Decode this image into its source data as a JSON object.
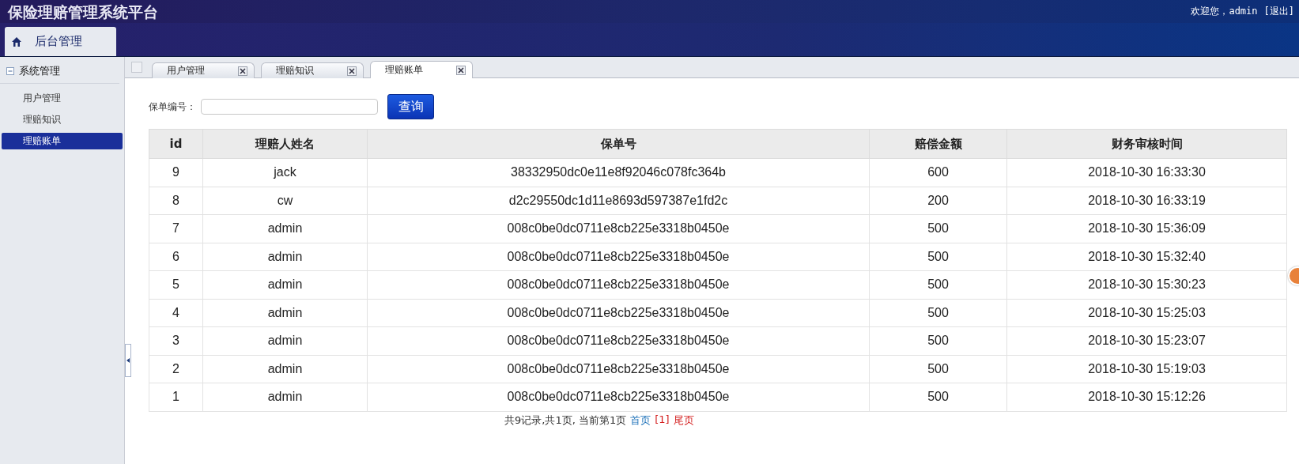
{
  "header": {
    "title": "保险理赔管理系统平台",
    "welcome": "欢迎您，admin",
    "logout": "[退出]"
  },
  "nav_tabs": [
    {
      "label": "后台管理",
      "selected": true
    }
  ],
  "sidebar": {
    "group": "系统管理",
    "expanded": true,
    "items": [
      {
        "label": "用户管理",
        "selected": false
      },
      {
        "label": "理赔知识",
        "selected": false
      },
      {
        "label": "理赔账单",
        "selected": true
      }
    ]
  },
  "tabs": [
    {
      "label": "用户管理",
      "selected": false
    },
    {
      "label": "理赔知识",
      "selected": false
    },
    {
      "label": "理赔账单",
      "selected": true
    }
  ],
  "search": {
    "label": "保单编号：",
    "button": "查询"
  },
  "table": {
    "columns": [
      "id",
      "理赔人姓名",
      "保单号",
      "赔偿金额",
      "财务审核时间"
    ],
    "rows": [
      [
        "9",
        "jack",
        "38332950dc0e11e8f92046c078fc364b",
        "600",
        "2018-10-30 16:33:30"
      ],
      [
        "8",
        "cw",
        "d2c29550dc1d11e8693d597387e1fd2c",
        "200",
        "2018-10-30 16:33:19"
      ],
      [
        "7",
        "admin",
        "008c0be0dc0711e8cb225e3318b0450e",
        "500",
        "2018-10-30 15:36:09"
      ],
      [
        "6",
        "admin",
        "008c0be0dc0711e8cb225e3318b0450e",
        "500",
        "2018-10-30 15:32:40"
      ],
      [
        "5",
        "admin",
        "008c0be0dc0711e8cb225e3318b0450e",
        "500",
        "2018-10-30 15:30:23"
      ],
      [
        "4",
        "admin",
        "008c0be0dc0711e8cb225e3318b0450e",
        "500",
        "2018-10-30 15:25:03"
      ],
      [
        "3",
        "admin",
        "008c0be0dc0711e8cb225e3318b0450e",
        "500",
        "2018-10-30 15:23:07"
      ],
      [
        "2",
        "admin",
        "008c0be0dc0711e8cb225e3318b0450e",
        "500",
        "2018-10-30 15:19:03"
      ],
      [
        "1",
        "admin",
        "008c0be0dc0711e8cb225e3318b0450e",
        "500",
        "2018-10-30 15:12:26"
      ]
    ]
  },
  "pager": {
    "summary": "共9记录,共1页, 当前第1页",
    "first": "首页",
    "current": "[1]",
    "last": "尾页"
  }
}
